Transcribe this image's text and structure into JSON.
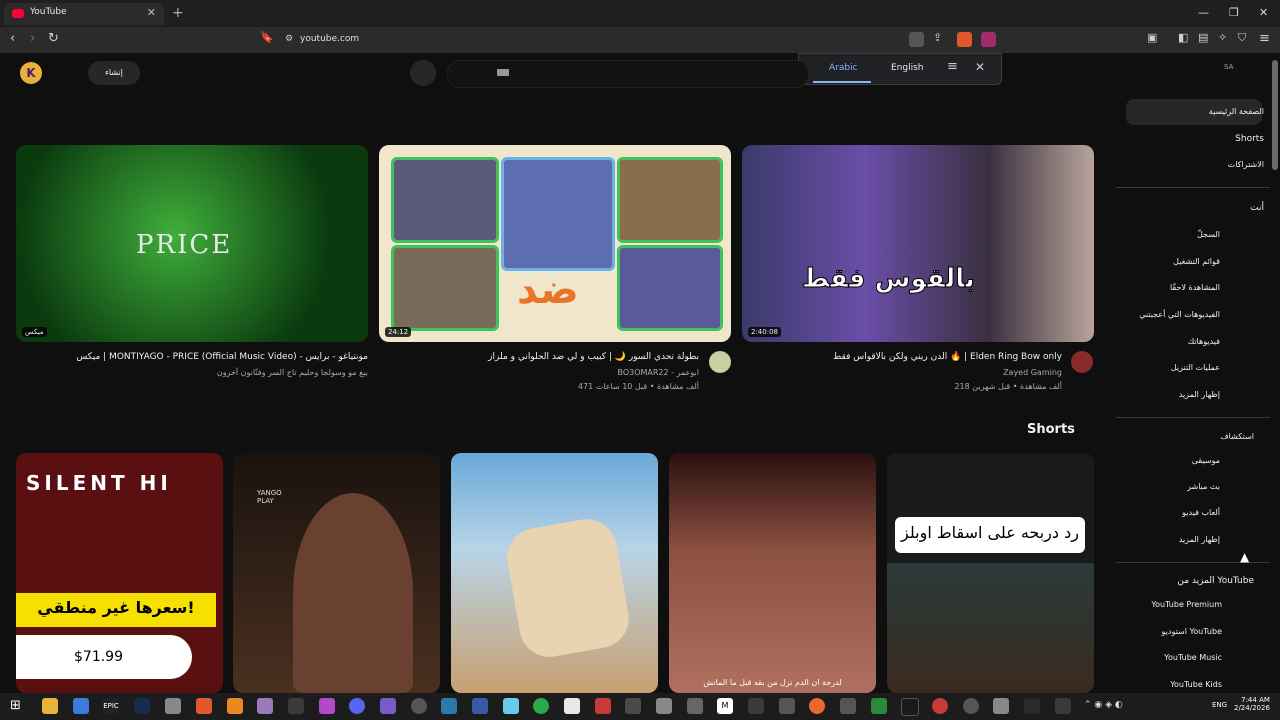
{
  "browser": {
    "tab_title": "YouTube",
    "url": "youtube.com",
    "translate": {
      "lang1": "Arabic",
      "lang2": "English"
    }
  },
  "header": {
    "create_label": "إنشاء",
    "region": "SA",
    "avatar_letter": "K"
  },
  "sidebar": {
    "main": [
      "الصفحة الرئيسية",
      "Shorts",
      "الاشتراكات"
    ],
    "you_header": "أنت",
    "you": [
      "السجلّ",
      "قوائم التشغيل",
      "المشاهدة لاحقًا",
      "الفيديوهات التي أعجبتني",
      "فيديوهاتك",
      "عمليات التنزيل",
      "إظهار المزيد"
    ],
    "explore_header": "استكشاف",
    "explore": [
      "موسيقى",
      "بث مباشر",
      "ألعاب فيديو",
      "إظهار المزيد"
    ],
    "more_header": "المزيد من YouTube",
    "more": [
      "YouTube Premium",
      "استوديو YouTube",
      "YouTube Music",
      "YouTube Kids"
    ]
  },
  "videos": [
    {
      "title": "ميكس | MONTIYAGO - PRICE (Official Music Video) - مونتياغو - برايس",
      "meta1": "بيغ مو وسولجا وحليم تاج السر وفنّانون آخرون",
      "meta2": "",
      "duration": "ميكس",
      "thumb_text": "PRICE"
    },
    {
      "title": "بطولة تحدي السور 🌙 | كبيب و لي ضد الحلواني و ملزاز",
      "meta1": "BO3OMAR22 - ابوعمر",
      "meta2": "471 ألف مشاهدة • قبل 10 ساعات",
      "duration": "24:12",
      "thumb_text": "ضد"
    },
    {
      "title": "الدن ريني ولكن بالاقواس فقط 🔥 | Elden Ring Bow only",
      "meta1": "Zayed Gaming",
      "meta2": "218 ألف مشاهدة • قبل شهرين",
      "duration": "2:40:08",
      "thumb_text": "بالقوس فقط"
    }
  ],
  "shorts_heading": "Shorts",
  "shorts": [
    {
      "caption": "رد دربحه على اسقاط اوبلز"
    },
    {
      "caption": "لدرجة ان الدم نزل من بقه قبل ما الماتش"
    },
    {
      "caption": ""
    },
    {
      "caption": "YANGO PLAY"
    },
    {
      "caption": "سعرها غير منطقي!",
      "price": "$71.99",
      "top": "SILENT HI"
    }
  ],
  "taskbar": {
    "lang": "ENG",
    "time": "7:44 AM",
    "date": "2/24/2026"
  },
  "colors": {
    "bg": "#0f0f0f",
    "accent": "#ff0033",
    "link": "#8ab4f8"
  }
}
